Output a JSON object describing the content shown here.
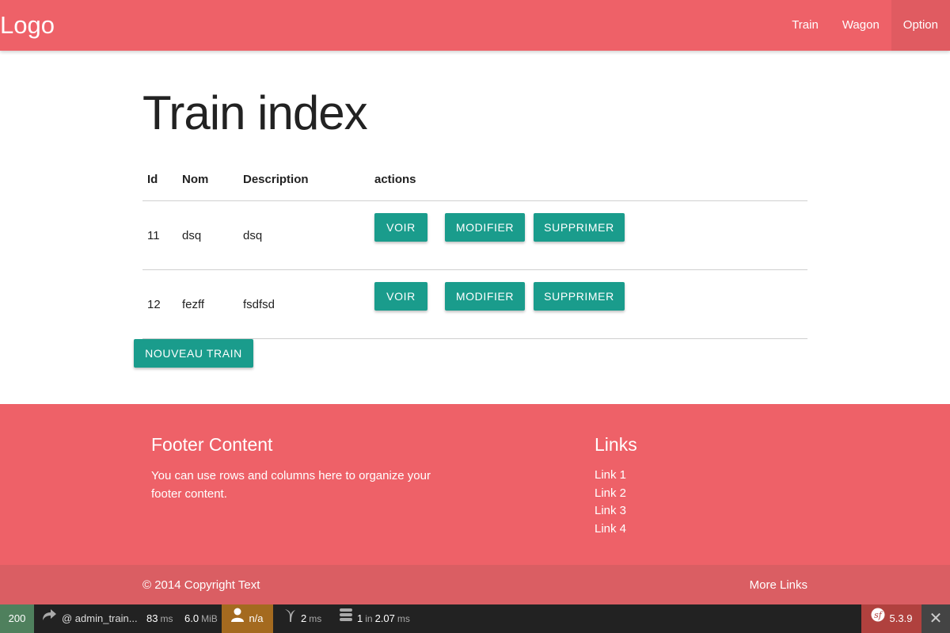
{
  "navbar": {
    "logo": "Logo",
    "links": [
      "Train",
      "Wagon",
      "Option"
    ]
  },
  "page": {
    "title": "Train index"
  },
  "table": {
    "headers": [
      "Id",
      "Nom",
      "Description",
      "actions"
    ],
    "rows": [
      {
        "id": "11",
        "nom": "dsq",
        "description": "dsq"
      },
      {
        "id": "12",
        "nom": "fezff",
        "description": "fsdfsd"
      }
    ],
    "actions": {
      "voir": "VOIR",
      "modifier": "MODIFIER",
      "supprimer": "SUPPRIMER"
    }
  },
  "new_button": "NOUVEAU TRAIN",
  "footer": {
    "title": "Footer Content",
    "text": "You can use rows and columns here to organize your footer content.",
    "links_title": "Links",
    "links": [
      "Link 1",
      "Link 2",
      "Link 3",
      "Link 4"
    ],
    "copyright": "© 2014 Copyright Text",
    "more_links": "More Links"
  },
  "toolbar": {
    "status": "200",
    "route": "@ admin_train...",
    "time_value": "83",
    "time_unit": "ms",
    "memory_value": "6.0",
    "memory_unit": "MiB",
    "user": "n/a",
    "twig_value": "2",
    "twig_unit": "ms",
    "db_count": "1",
    "db_in": "in",
    "db_time": "2.07",
    "db_unit": "ms",
    "version": "5.3.9",
    "close": "✕"
  },
  "colors": {
    "primary": "#ee6168",
    "teal": "#1a9c8c",
    "copyright_bar": "#da5e63",
    "toolbar_bg": "#222222"
  }
}
